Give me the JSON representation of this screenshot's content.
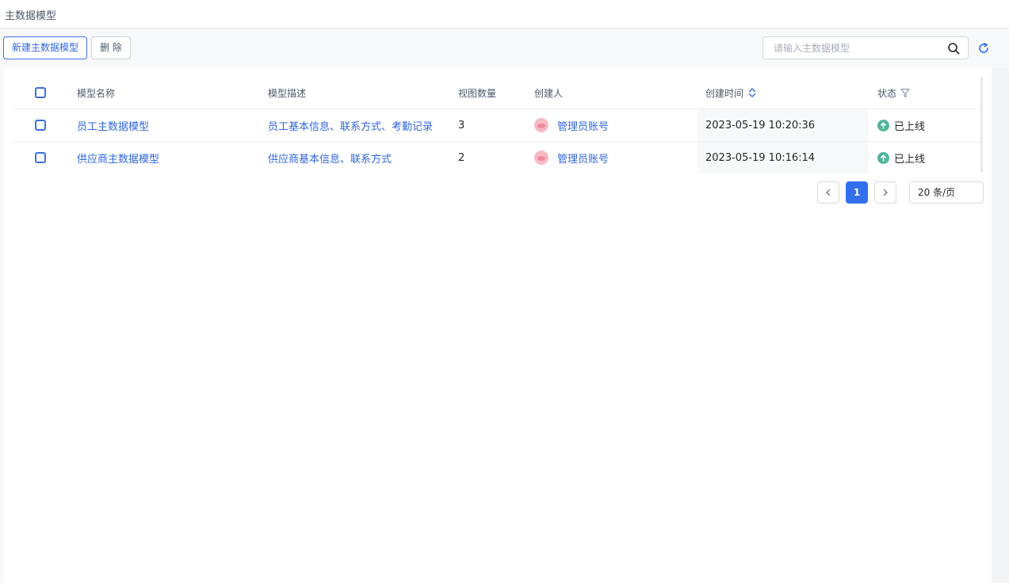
{
  "page": {
    "title": "主数据模型"
  },
  "toolbar": {
    "new_label": "新建主数据模型",
    "delete_label": "删 除",
    "search_placeholder": "请输入主数据模型"
  },
  "table": {
    "columns": {
      "name": "模型名称",
      "description": "模型描述",
      "view_count": "视图数量",
      "creator": "创建人",
      "created_time": "创建时间",
      "status": "状态"
    },
    "rows": [
      {
        "name": "员工主数据模型",
        "description": "员工基本信息、联系方式、考勤记录",
        "view_count": "3",
        "creator": "管理员账号",
        "created_time": "2023-05-19 10:20:36",
        "status": "已上线"
      },
      {
        "name": "供应商主数据模型",
        "description": "供应商基本信息、联系方式",
        "view_count": "2",
        "creator": "管理员账号",
        "created_time": "2023-05-19 10:16:14",
        "status": "已上线"
      }
    ]
  },
  "pagination": {
    "current_page": "1",
    "page_size": "20 条/页"
  },
  "colors": {
    "accent": "#3370f0",
    "link": "#3066e0",
    "status_online": "#52b59a"
  },
  "icons": [
    "search-icon",
    "refresh-icon",
    "sort-icon",
    "filter-icon",
    "arrow-up-circle-icon",
    "avatar",
    "chevron-left-icon",
    "chevron-right-icon"
  ]
}
